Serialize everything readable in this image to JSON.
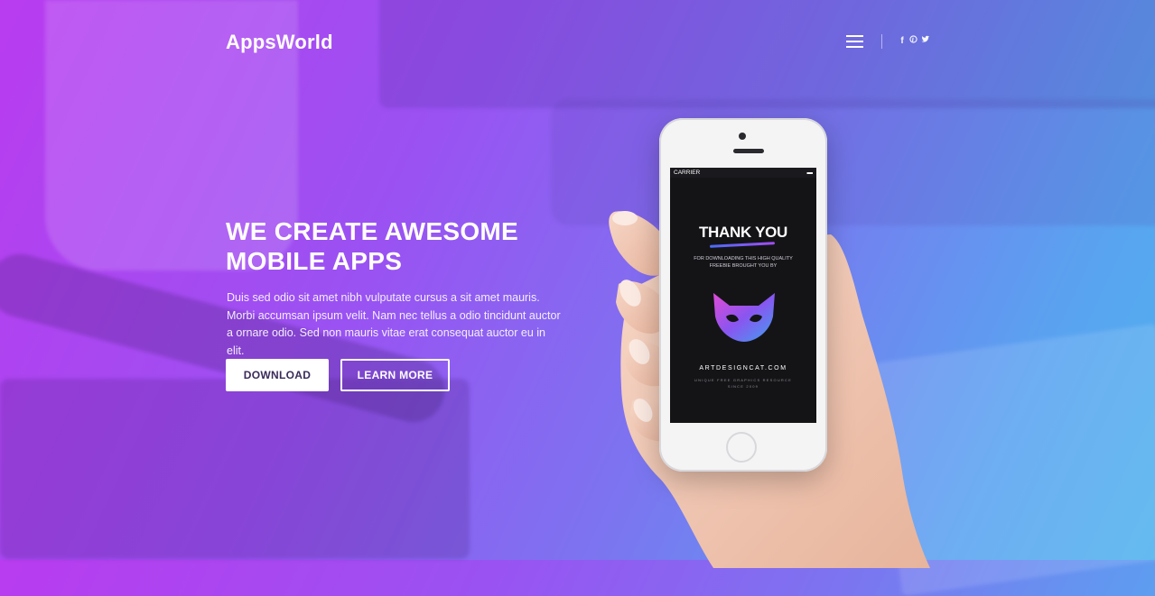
{
  "nav": {
    "logo": "AppsWorld"
  },
  "hero": {
    "headline": "WE CREATE AWESOME MOBILE APPS",
    "description": "Duis sed odio sit amet nibh vulputate cursus a sit amet mauris. Morbi accumsan ipsum velit. Nam nec tellus a odio tincidunt auctor a ornare odio. Sed non  mauris vitae erat consequat auctor eu in elit.",
    "download_label": "DOWNLOAD",
    "learn_more_label": "LEARN MORE"
  },
  "phone_screen": {
    "carrier": "CARRIER",
    "title": "THANK YOU",
    "subtitle": "FOR DOWNLOADING THIS HIGH QUALITY FREEBIE BROUGHT YOU BY",
    "site": "ARTDESIGNCAT.COM",
    "tagline": "UNIQUE FREE GRAPHICS RESOURCE",
    "since": "SINCE 2009"
  },
  "icons": {
    "menu": "hamburger-icon",
    "facebook": "facebook-icon",
    "pinterest": "pinterest-icon",
    "twitter": "twitter-icon"
  },
  "colors": {
    "gradient_start": "#b93cf0",
    "gradient_end": "#4fb2ee",
    "button_text": "#3a2a5a"
  }
}
